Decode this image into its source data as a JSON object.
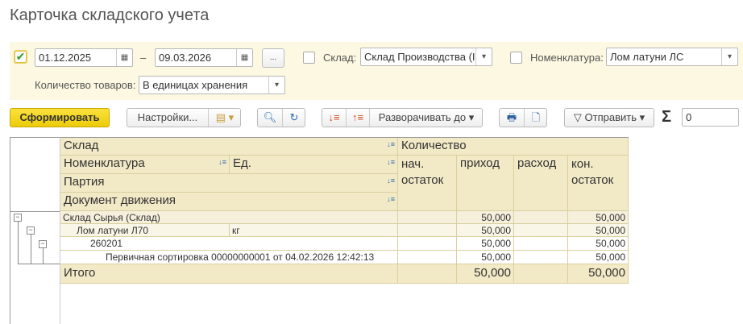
{
  "title": "Карточка складского учета",
  "filters": {
    "period_enabled": true,
    "date_from": "01.12.2025",
    "dash": "–",
    "date_to": "09.03.2026",
    "period_btn": "...",
    "warehouse_label": "Склад:",
    "warehouse_value": "Склад Производства (І",
    "nomenclature_label": "Номенклатура:",
    "nomenclature_value": "Лом латуни ЛС",
    "qty_label": "Количество товаров:",
    "qty_value": "В единицах хранения"
  },
  "toolbar": {
    "generate": "Сформировать",
    "settings": "Настройки...",
    "expand": "Разворачивать до",
    "send": "Отправить",
    "sigma": "Σ",
    "sum_value": "0"
  },
  "table": {
    "headers": {
      "warehouse": "Склад",
      "nomenclature": "Номенклатура",
      "unit": "Ед.",
      "batch": "Партия",
      "document": "Документ движения",
      "quantity": "Количество",
      "opening": "нач. остаток",
      "incoming": "приход",
      "outgoing": "расход",
      "closing": "кон. остаток"
    },
    "rows": [
      {
        "label": "Склад Сырья (Склад)",
        "unit": "",
        "opening": "",
        "incoming": "50,000",
        "outgoing": "",
        "closing": "50,000"
      },
      {
        "label": "Лом латуни Л70",
        "unit": "кг",
        "opening": "",
        "incoming": "50,000",
        "outgoing": "",
        "closing": "50,000"
      },
      {
        "label": "260201",
        "unit": "",
        "opening": "",
        "incoming": "50,000",
        "outgoing": "",
        "closing": "50,000"
      },
      {
        "label": "Первичная сортировка 00000000001 от 04.02.2026 12:42:13",
        "unit": "",
        "opening": "",
        "incoming": "50,000",
        "outgoing": "",
        "closing": "50,000"
      }
    ],
    "total": {
      "label": "Итого",
      "opening": "",
      "incoming": "50,000",
      "outgoing": "",
      "closing": "50,000"
    }
  }
}
